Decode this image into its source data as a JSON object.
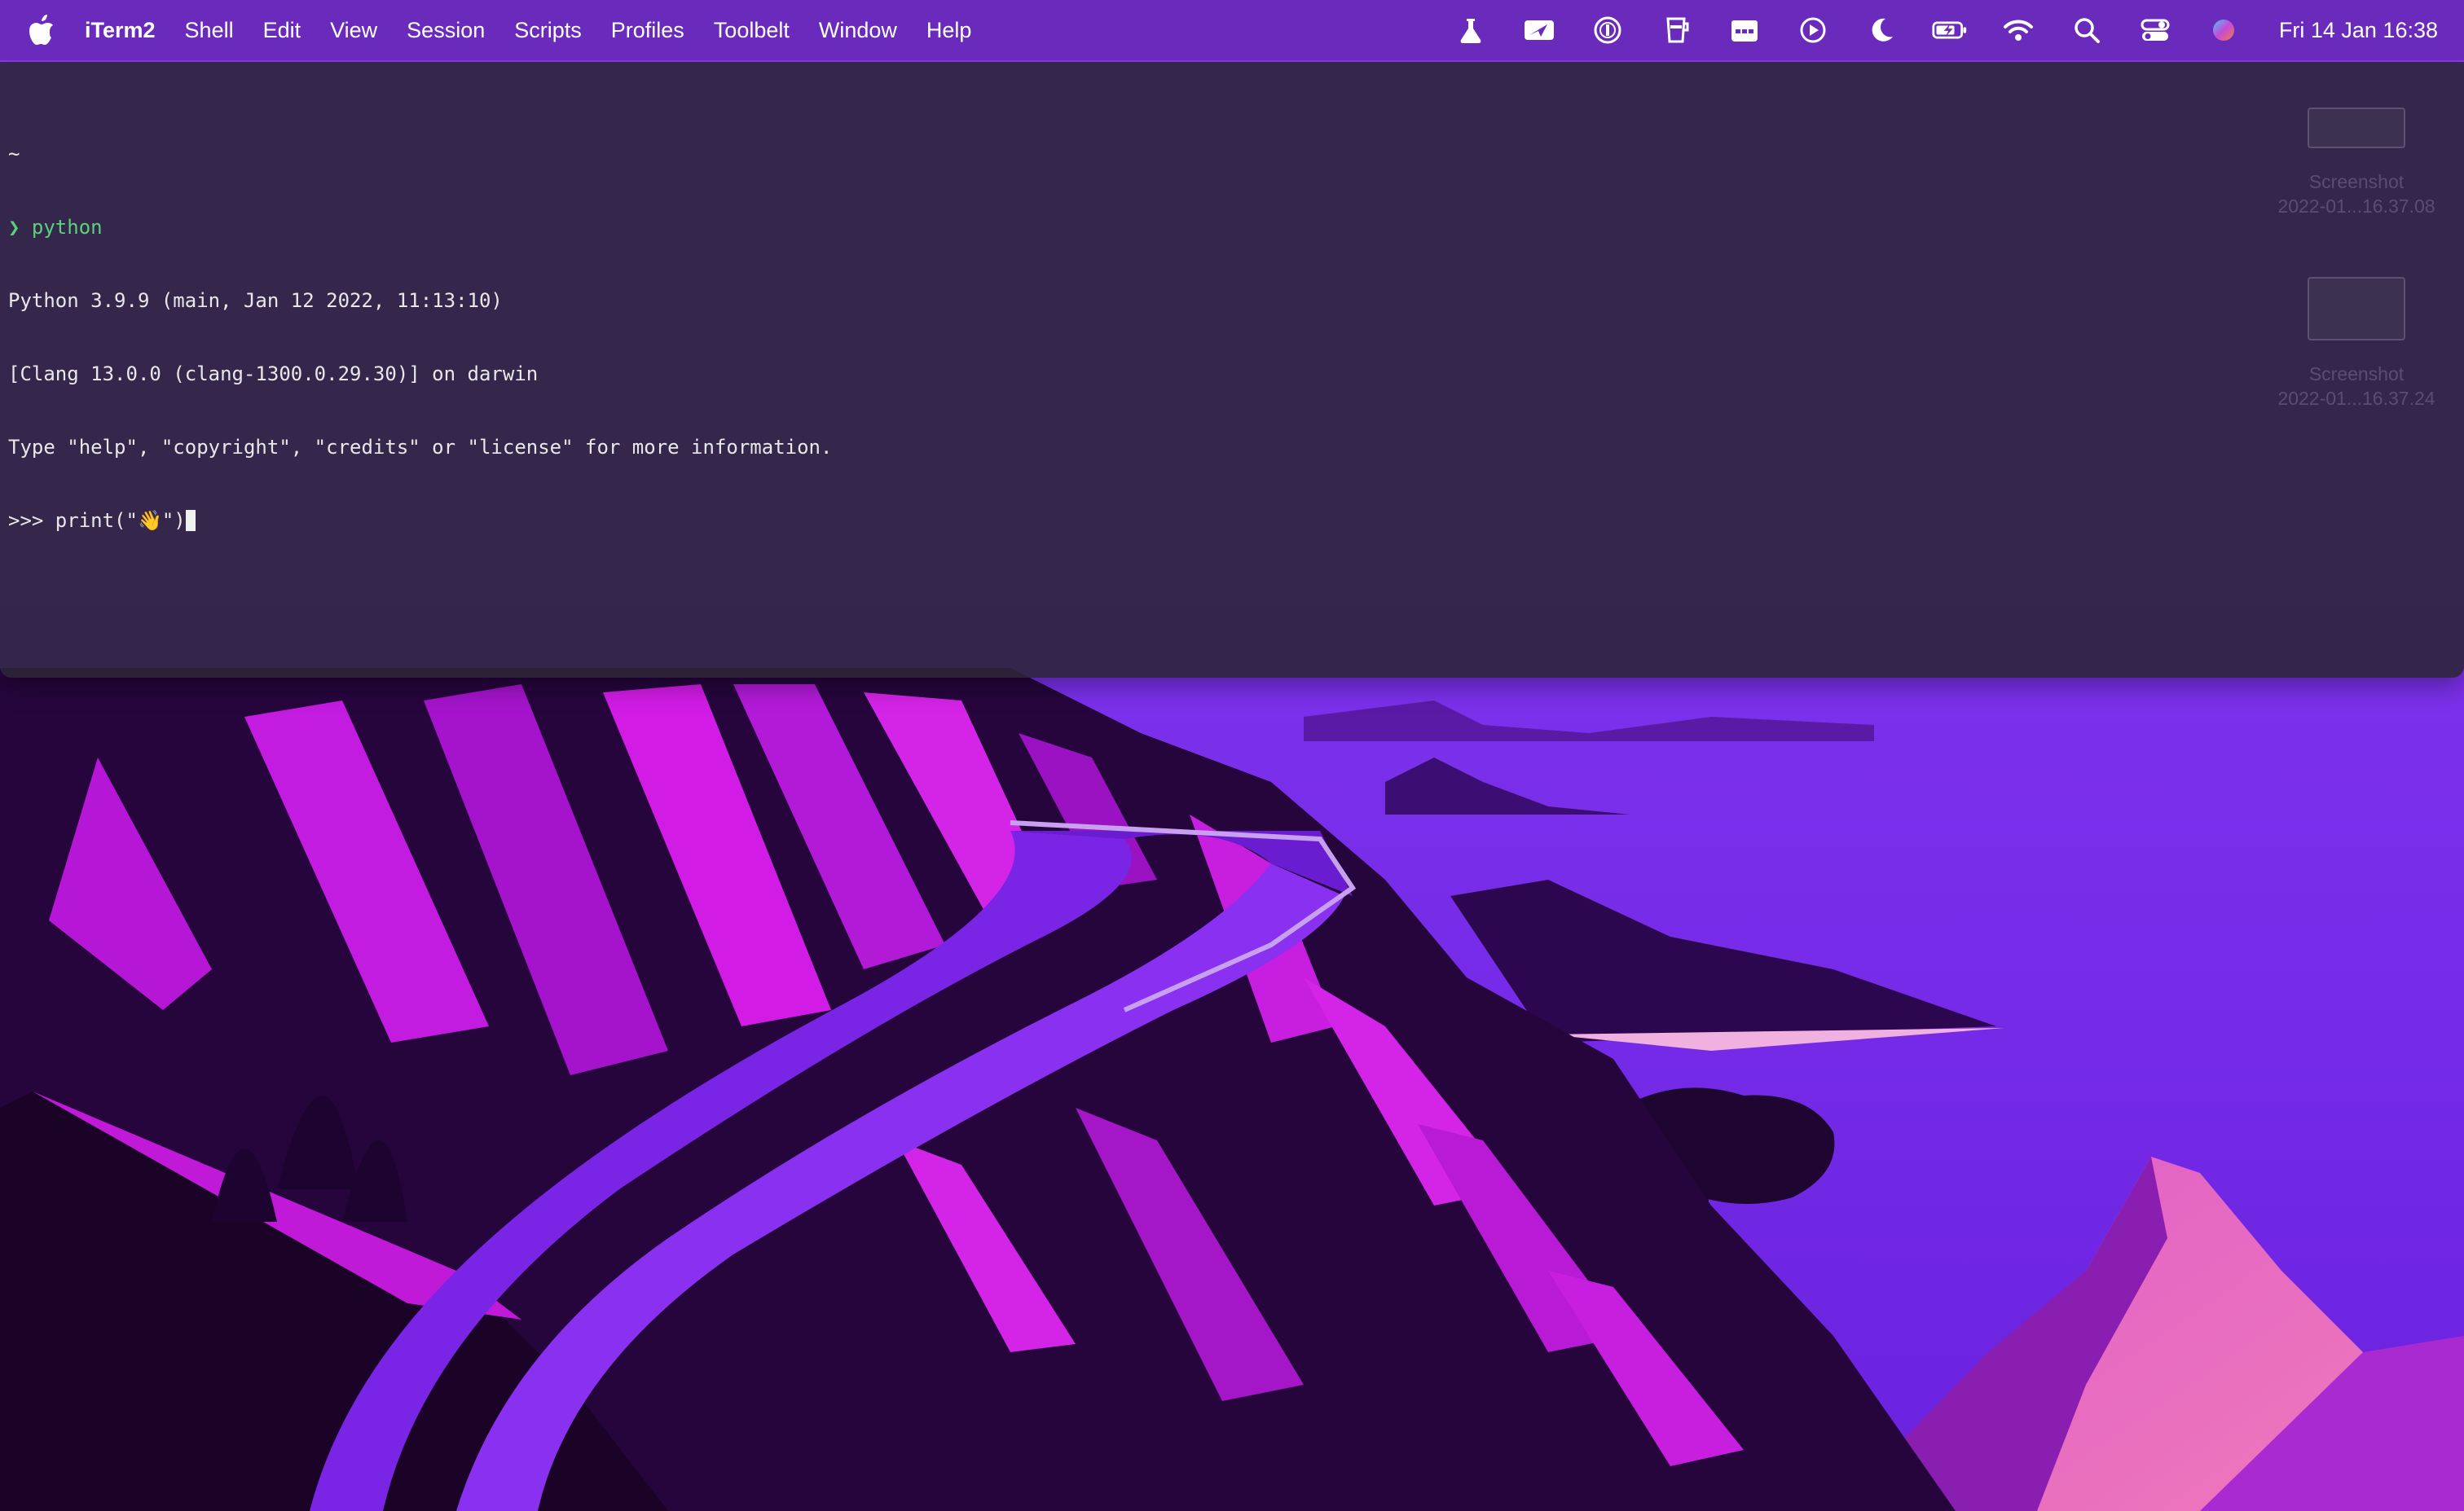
{
  "menubar": {
    "app_name": "iTerm2",
    "items": [
      "Shell",
      "Edit",
      "View",
      "Session",
      "Scripts",
      "Profiles",
      "Toolbelt",
      "Window",
      "Help"
    ],
    "status_icons": [
      "flask-icon",
      "paper-plane-icon",
      "password-manager-icon",
      "cup-icon",
      "calendar-icon",
      "play-icon",
      "moon-icon",
      "battery-icon",
      "wifi-icon",
      "search-icon",
      "control-center-icon",
      "siri-icon"
    ],
    "clock": "Fri 14 Jan  16:38"
  },
  "terminal": {
    "cwd": "~",
    "prompt_symbol": "❯",
    "command": "python",
    "output": [
      "Python 3.9.9 (main, Jan 12 2022, 11:13:10)",
      "[Clang 13.0.0 (clang-1300.0.29.30)] on darwin",
      "Type \"help\", \"copyright\", \"credits\" or \"license\" for more information."
    ],
    "repl_prompt": ">>> ",
    "repl_input": "print(\"👋\")"
  },
  "desktop": {
    "files": [
      {
        "name": "Screenshot",
        "date": "2022-01...16.37.08"
      },
      {
        "name": "Screenshot",
        "date": "2022-01...16.37.24"
      }
    ]
  },
  "colors": {
    "menubar": "#6a2bbd",
    "terminal_bg": "#2c2638",
    "prompt_green": "#5ad27a",
    "wallpaper_sky": "#7a2cf0",
    "wallpaper_magenta": "#d21ce6",
    "wallpaper_dark": "#1a0326"
  }
}
